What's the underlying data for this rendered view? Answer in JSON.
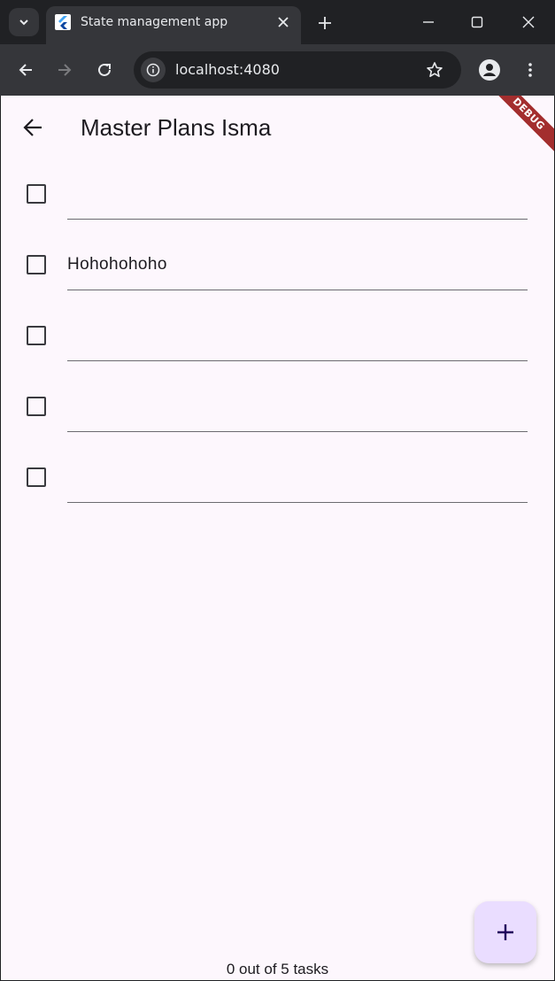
{
  "browser": {
    "tab_title": "State management app",
    "url": "localhost:4080",
    "icons": {
      "tab_search": "chevron-down-icon",
      "favicon": "flutter-icon",
      "tab_close": "close-icon",
      "new_tab": "plus-icon",
      "minimize": "minimize-icon",
      "maximize": "maximize-icon",
      "close_window": "close-icon",
      "back": "arrow-left-icon",
      "forward": "arrow-right-icon",
      "reload": "reload-icon",
      "site_info": "info-icon",
      "bookmark": "star-icon",
      "profile": "account-icon",
      "menu": "more-vert-icon"
    }
  },
  "app": {
    "title": "Master Plans Isma",
    "debug_banner": "DEBUG",
    "tasks": [
      {
        "text": "",
        "checked": false
      },
      {
        "text": "Hohohohoho",
        "checked": false
      },
      {
        "text": "",
        "checked": false
      },
      {
        "text": "",
        "checked": false
      },
      {
        "text": "",
        "checked": false
      }
    ],
    "footer": "0 out of 5 tasks",
    "fab_icon": "plus-icon",
    "colors": {
      "background": "#fdf7fd",
      "fab": "#eaddff",
      "debug_banner": "#a32e2e"
    }
  }
}
